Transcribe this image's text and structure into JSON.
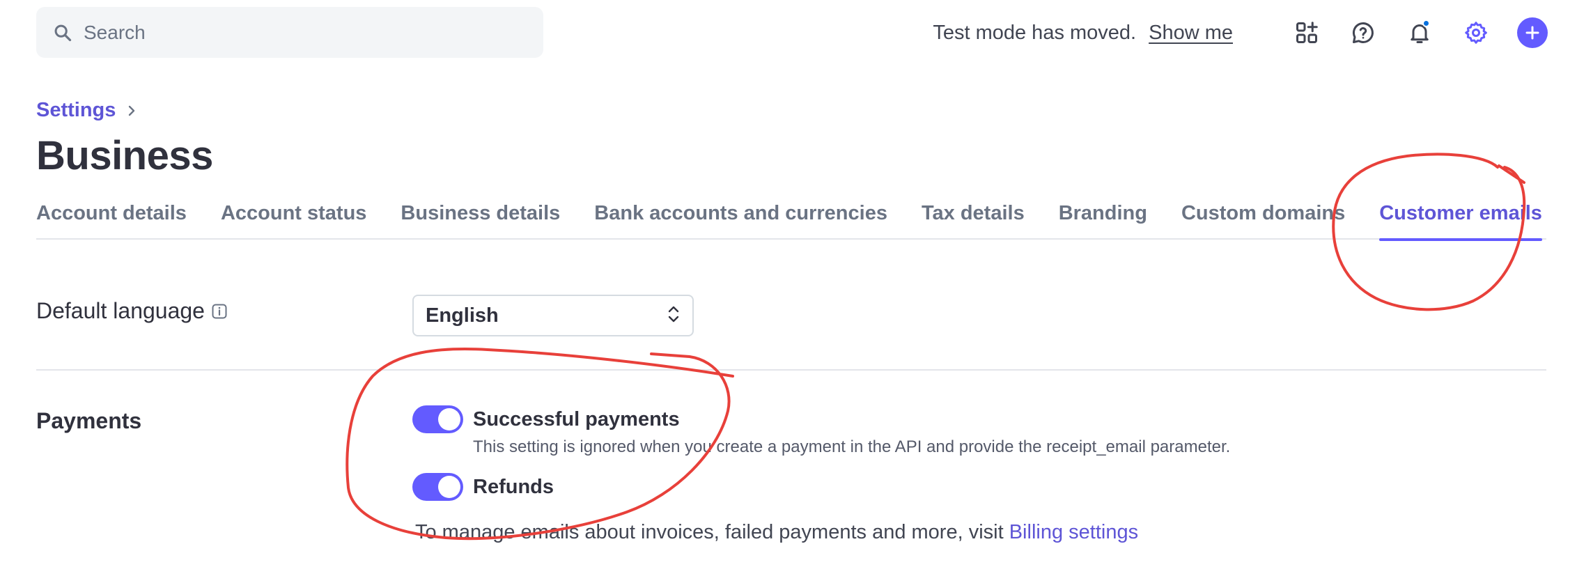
{
  "search": {
    "placeholder": "Search"
  },
  "topbar": {
    "notice": "Test mode has moved.",
    "show_me": "Show me",
    "icons": [
      "apps-add-icon",
      "help-icon",
      "bell-icon",
      "gear-icon",
      "plus-icon"
    ]
  },
  "breadcrumb": {
    "parent": "Settings"
  },
  "page": {
    "title": "Business"
  },
  "tabs": [
    {
      "label": "Account details"
    },
    {
      "label": "Account status"
    },
    {
      "label": "Business details"
    },
    {
      "label": "Bank accounts and currencies"
    },
    {
      "label": "Tax details"
    },
    {
      "label": "Branding"
    },
    {
      "label": "Custom domains"
    },
    {
      "label": "Customer emails",
      "active": true
    }
  ],
  "language": {
    "label": "Default language",
    "value": "English"
  },
  "payments": {
    "label": "Payments",
    "options": [
      {
        "title": "Successful payments",
        "enabled": true,
        "description": "This setting is ignored when you create a payment in the API and provide the receipt_email parameter."
      },
      {
        "title": "Refunds",
        "enabled": true
      }
    ],
    "note_prefix": "To manage emails about invoices, failed payments and more, visit ",
    "note_link": "Billing settings"
  },
  "colors": {
    "accent": "#635bff",
    "link": "#5e55d6",
    "annotation": "#e8403a",
    "notification_dot": "#0570de"
  }
}
